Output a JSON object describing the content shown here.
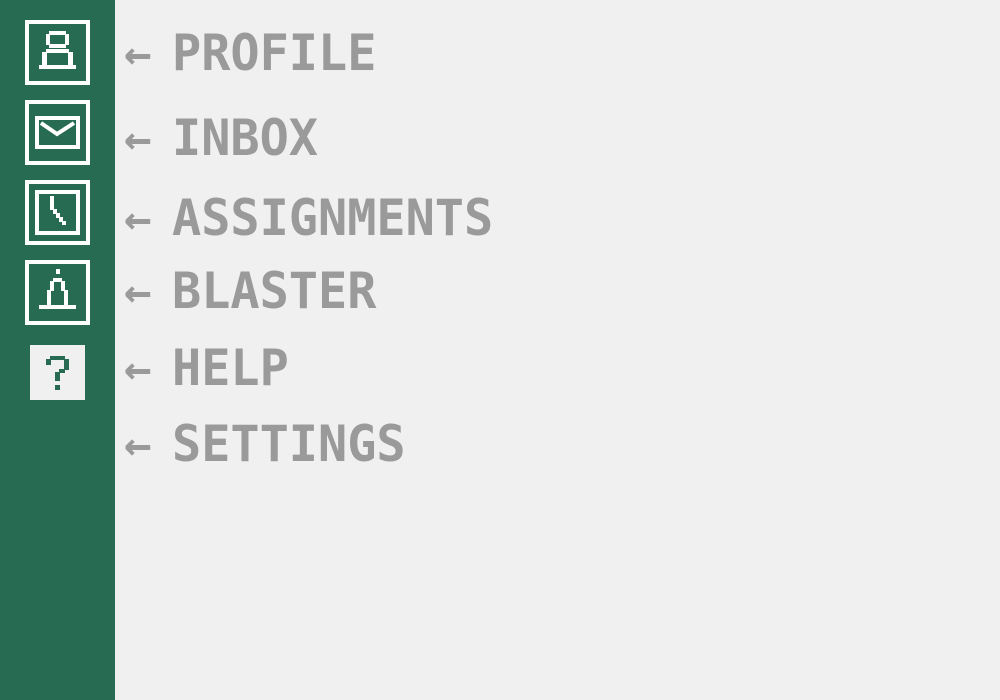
{
  "colors": {
    "sidebar": "#276b52",
    "background": "#f0f0f0",
    "label": "#9a9a9a",
    "icon": "#ffffff"
  },
  "arrow_glyph": "←",
  "menu": [
    {
      "label": "PROFILE",
      "icon": "person-icon"
    },
    {
      "label": "INBOX",
      "icon": "envelope-icon"
    },
    {
      "label": "ASSIGNMENTS",
      "icon": "clock-icon"
    },
    {
      "label": "BLASTER",
      "icon": "compass-icon"
    },
    {
      "label": "HELP",
      "icon": "question-mark-icon"
    },
    {
      "label": "SETTINGS",
      "icon": ""
    }
  ]
}
